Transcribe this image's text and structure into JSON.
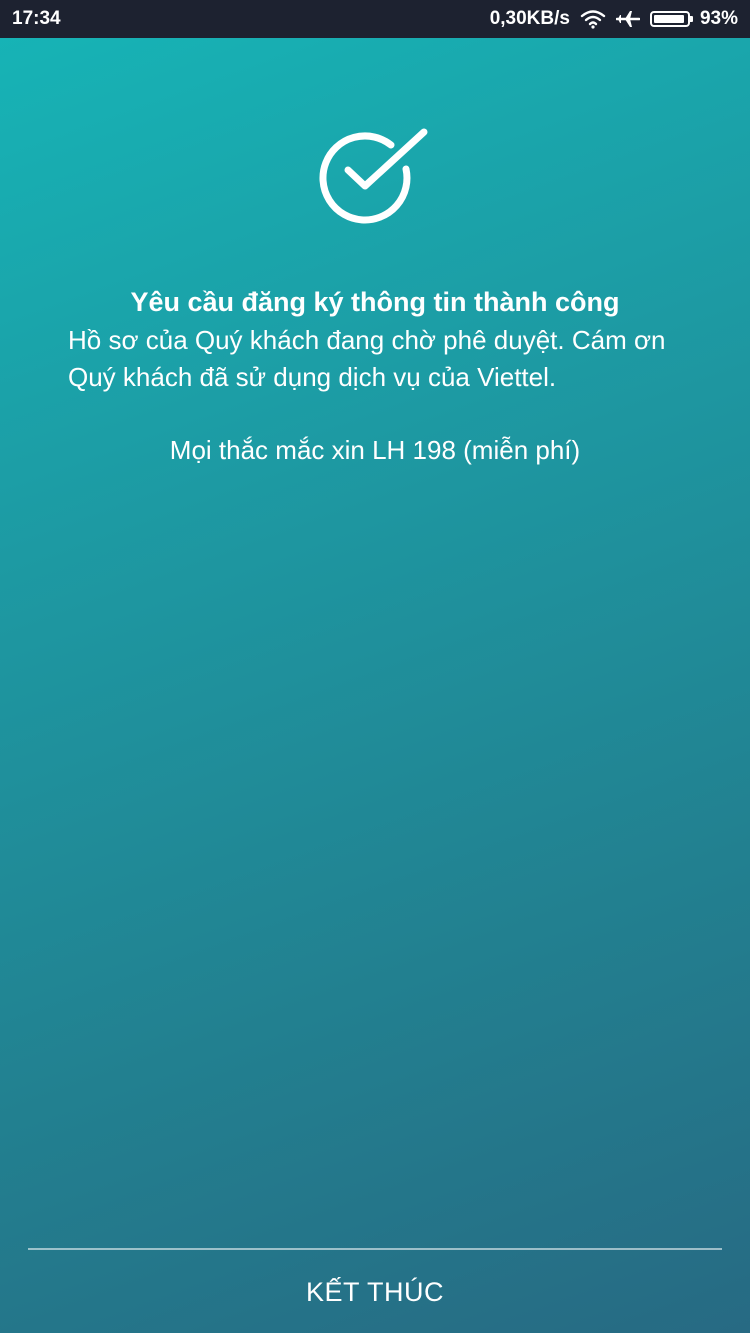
{
  "status_bar": {
    "time": "17:34",
    "network_speed": "0,30KB/s",
    "battery_percent": "93%",
    "battery_level": 0.93,
    "icons": [
      "wifi-icon",
      "airplane-mode-icon",
      "battery-icon"
    ]
  },
  "success": {
    "icon": "check-circle-icon",
    "title": "Yêu cầu đăng ký thông tin thành công",
    "message": "Hồ sơ của Quý khách đang chờ phê duyệt. Cám ơn Quý khách đã sử dụng dịch vụ của Viettel.",
    "hotline": "Mọi thắc mắc xin LH 198 (miễn phí)"
  },
  "footer": {
    "finish_label": "KẾT THÚC"
  },
  "colors": {
    "gradient_start": "#16b5b7",
    "gradient_end": "#276a83",
    "status_bar": "#1d2230",
    "text": "#ffffff"
  }
}
